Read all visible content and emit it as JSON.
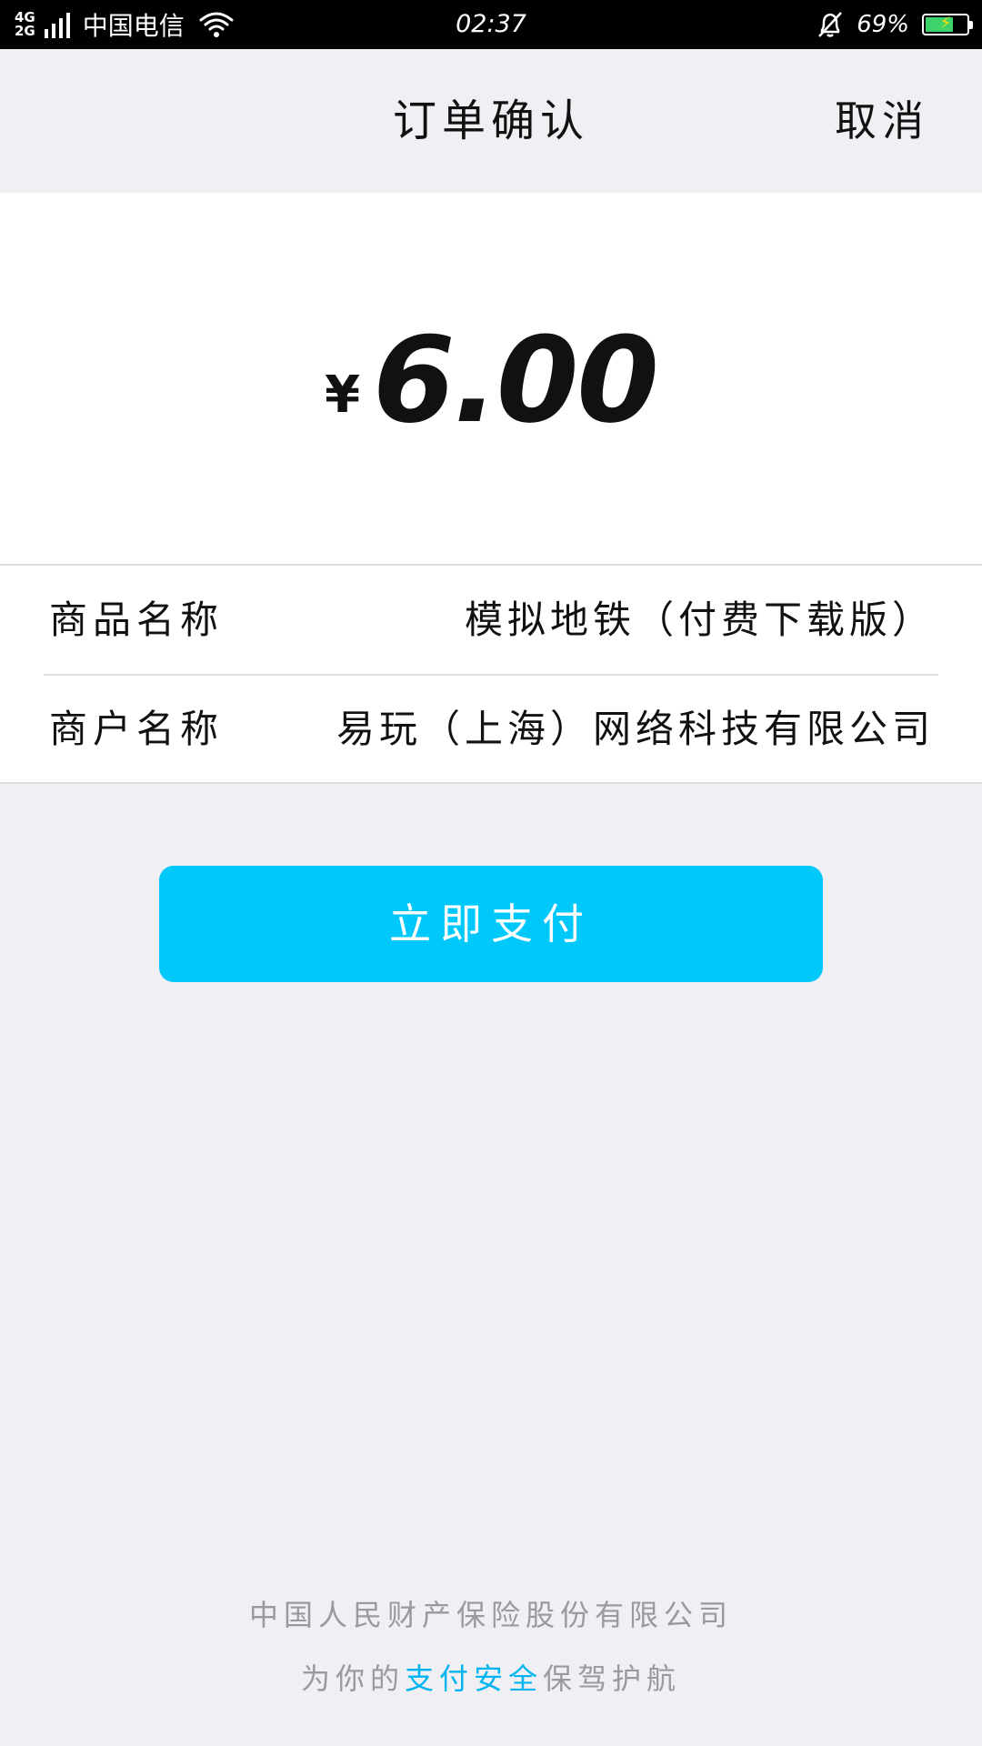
{
  "status_bar": {
    "network_top": "4G",
    "network_bottom": "2G",
    "carrier": "中国电信",
    "time": "02:37",
    "battery_percent": "69%",
    "battery_level": 0.69,
    "icons": [
      "signal-icon",
      "wifi-icon",
      "notification-off-icon",
      "battery-charging-icon"
    ]
  },
  "navbar": {
    "title": "订单确认",
    "cancel_label": "取消"
  },
  "amount": {
    "currency_symbol": "¥",
    "value": "6.00"
  },
  "info": {
    "product_label": "商品名称",
    "product_value": "模拟地铁（付费下载版）",
    "merchant_label": "商户名称",
    "merchant_value": "易玩（上海）网络科技有限公司"
  },
  "pay_button": {
    "label": "立即支付"
  },
  "footer": {
    "line1": "中国人民财产保险股份有限公司",
    "line2_prefix": "为你的",
    "line2_highlight": "支付安全",
    "line2_suffix": "保驾护航"
  },
  "colors": {
    "primary": "#00c8fa",
    "background": "#efeff4",
    "highlight_text": "#00b4ef",
    "footer_text": "#9a9a9e"
  }
}
